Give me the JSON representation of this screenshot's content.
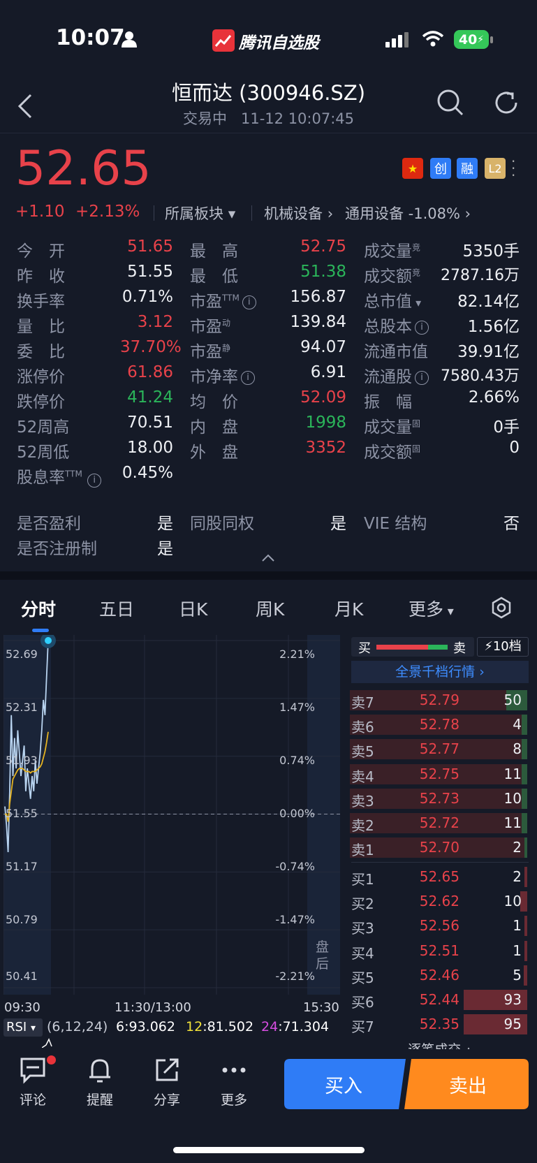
{
  "status_bar": {
    "time": "10:07",
    "app_name": "腾讯自选股",
    "battery": "40"
  },
  "header": {
    "title": "恒而达 (300946.SZ)",
    "status": "交易中",
    "datetime": "11-12 10:07:45"
  },
  "quote": {
    "price": "52.65",
    "change": "+1.10",
    "change_pct": "+2.13%",
    "sector_label": "所属板块",
    "industry": "机械设备",
    "sub_industry": "通用设备 -1.08%"
  },
  "badges": {
    "chuang": "创",
    "rong": "融",
    "l2": "L2"
  },
  "stats": {
    "col1": [
      {
        "label": "今　开",
        "value": "51.65",
        "color": "red"
      },
      {
        "label": "昨　收",
        "value": "51.55",
        "color": "white"
      },
      {
        "label": "换手率",
        "value": "0.71%",
        "color": "white"
      },
      {
        "label": "量　比",
        "value": "3.12",
        "color": "red"
      },
      {
        "label": "委　比",
        "value": "37.70%",
        "color": "red"
      },
      {
        "label": "涨停价",
        "value": "61.86",
        "color": "red"
      },
      {
        "label": "跌停价",
        "value": "41.24",
        "color": "green"
      },
      {
        "label": "52周高",
        "value": "70.51",
        "color": "white"
      },
      {
        "label": "52周低",
        "value": "18.00",
        "color": "white"
      }
    ],
    "col2": [
      {
        "label": "最　高",
        "value": "52.75",
        "color": "red"
      },
      {
        "label": "最　低",
        "value": "51.38",
        "color": "green"
      },
      {
        "label": "市盈",
        "sup": "TTM",
        "value": "156.87",
        "color": "white",
        "info": true
      },
      {
        "label": "市盈",
        "sup": "动",
        "value": "139.84",
        "color": "white"
      },
      {
        "label": "市盈",
        "sup": "静",
        "value": "94.07",
        "color": "white"
      },
      {
        "label": "市净率",
        "value": "6.91",
        "color": "white",
        "info": true
      },
      {
        "label": "均　价",
        "value": "52.09",
        "color": "red"
      },
      {
        "label": "内　盘",
        "value": "1998",
        "color": "green"
      },
      {
        "label": "外　盘",
        "value": "3352",
        "color": "red"
      }
    ],
    "col3": [
      {
        "label": "成交量",
        "sup": "竞",
        "value": "5350手",
        "color": "white"
      },
      {
        "label": "成交额",
        "sup": "竞",
        "value": "2787.16万",
        "color": "white"
      },
      {
        "label": "总市值",
        "value": "82.14亿",
        "color": "white",
        "caret": true
      },
      {
        "label": "总股本",
        "value": "1.56亿",
        "color": "white",
        "info": true
      },
      {
        "label": "流通市值",
        "value": "39.91亿",
        "color": "white"
      },
      {
        "label": "流通股",
        "value": "7580.43万",
        "color": "white",
        "info": true
      },
      {
        "label": "振　幅",
        "value": "2.66%",
        "color": "white"
      },
      {
        "label": "成交量",
        "sup": "固",
        "value": "0手",
        "color": "white"
      },
      {
        "label": "成交额",
        "sup": "固",
        "value": "0",
        "color": "white"
      }
    ],
    "dividend": {
      "label": "股息率",
      "sup": "TTM",
      "value": "0.45%"
    }
  },
  "flags": [
    {
      "label": "是否盈利",
      "value": "是"
    },
    {
      "label": "同股同权",
      "value": "是"
    },
    {
      "label": "VIE 结构",
      "value": "否"
    },
    {
      "label": "是否注册制",
      "value": "是"
    }
  ],
  "tabs": [
    "分时",
    "五日",
    "日K",
    "周K",
    "月K",
    "更多"
  ],
  "chart": {
    "left_axis": [
      "52.69",
      "52.31",
      "51.93",
      "51.55",
      "51.17",
      "50.79",
      "50.41"
    ],
    "right_axis": [
      "2.21%",
      "1.47%",
      "0.74%",
      "0.00%",
      "-0.74%",
      "-1.47%",
      "-2.21%"
    ],
    "time_labels": [
      "09:30",
      "11:30/13:00",
      "15:30"
    ],
    "after_hours": "盘后",
    "rsi": {
      "name": "RSI",
      "params": "(6,12,24)",
      "r6_label": "6",
      "r6": "93.062",
      "r12_label": "12",
      "r12": "81.502",
      "r24_label": "24",
      "r24": "71.304"
    }
  },
  "chart_data": {
    "type": "line",
    "ylim": [
      50.41,
      52.69
    ],
    "yticks": [
      "52.69",
      "52.31",
      "51.93",
      "51.55",
      "51.17",
      "50.79",
      "50.41"
    ],
    "y2ticks": [
      "2.21%",
      "1.47%",
      "0.74%",
      "0.00%",
      "-0.74%",
      "-1.47%",
      "-2.21%"
    ],
    "xticks": [
      "09:30",
      "11:30/13:00",
      "15:30"
    ],
    "prev_close": 51.55,
    "series": [
      {
        "color": "#b9d4f0",
        "values": [
          51.6,
          51.48,
          51.3,
          51.7,
          52.2,
          51.8,
          52.05,
          51.85,
          52.1,
          51.95,
          51.8,
          51.9,
          52.0,
          51.7,
          51.85,
          51.75,
          51.65,
          51.8,
          51.7,
          51.9,
          51.75,
          51.85,
          51.95,
          52.1,
          52.3,
          52.2,
          52.45,
          52.69
        ]
      },
      {
        "color": "#e6b422",
        "values": [
          51.55,
          51.55,
          51.5,
          51.62,
          51.7,
          51.78,
          51.8,
          51.82,
          51.84,
          51.85,
          51.85,
          51.85,
          51.84,
          51.83,
          51.83,
          51.83,
          51.82,
          51.83,
          51.83,
          51.83,
          51.84,
          51.85,
          51.86,
          51.88,
          51.92,
          51.96,
          52.02,
          52.09
        ]
      }
    ]
  },
  "orderbook": {
    "buy": "买",
    "sell": "卖",
    "levels": "10档",
    "panorama": "全景千档行情",
    "asks": [
      {
        "label": "卖7",
        "price": "52.79",
        "vol": "50",
        "vb": 0.12
      },
      {
        "label": "卖6",
        "price": "52.78",
        "vol": "4",
        "vb": 0.03
      },
      {
        "label": "卖5",
        "price": "52.77",
        "vol": "8",
        "vb": 0.03
      },
      {
        "label": "卖4",
        "price": "52.75",
        "vol": "11",
        "vb": 0.03
      },
      {
        "label": "卖3",
        "price": "52.73",
        "vol": "10",
        "vb": 0.03
      },
      {
        "label": "卖2",
        "price": "52.72",
        "vol": "11",
        "vb": 0.03
      },
      {
        "label": "卖1",
        "price": "52.70",
        "vol": "2",
        "vb": 0.01
      }
    ],
    "bids": [
      {
        "label": "买1",
        "price": "52.65",
        "vol": "2",
        "vb": 0.01
      },
      {
        "label": "买2",
        "price": "52.62",
        "vol": "10",
        "vb": 0.04
      },
      {
        "label": "买3",
        "price": "52.56",
        "vol": "1",
        "vb": 0.01
      },
      {
        "label": "买4",
        "price": "52.51",
        "vol": "1",
        "vb": 0.01
      },
      {
        "label": "买5",
        "price": "52.46",
        "vol": "5",
        "vb": 0.02
      },
      {
        "label": "买6",
        "price": "52.44",
        "vol": "93",
        "vb": 0.36
      },
      {
        "label": "买7",
        "price": "52.35",
        "vol": "95",
        "vb": 0.36
      }
    ],
    "trades": "逐笔成交"
  },
  "bottom_nav": {
    "comment": "评论",
    "remind": "提醒",
    "share": "分享",
    "more": "更多",
    "buy": "买入",
    "sell": "卖出"
  },
  "colors": {
    "up": "#e8424a",
    "down": "#2bb55a",
    "accent": "#2f7cf6",
    "sell_btn": "#ff8a1e",
    "bg": "#151a27"
  }
}
